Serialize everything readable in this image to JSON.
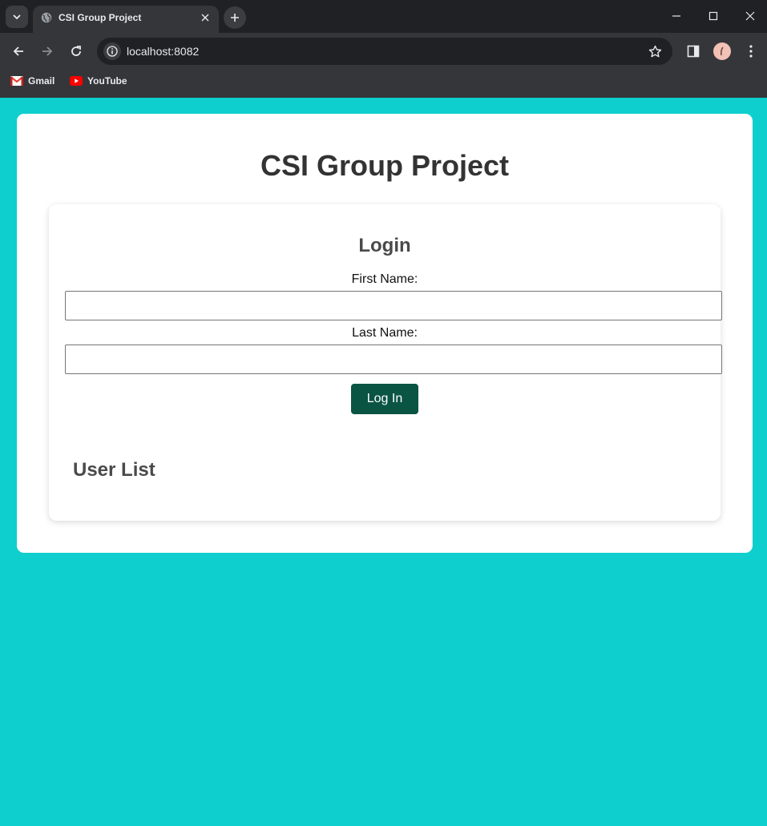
{
  "browser": {
    "tab_title": "CSI Group Project",
    "url": "localhost:8082",
    "bookmarks": [
      {
        "label": "Gmail",
        "icon": "gmail-icon"
      },
      {
        "label": "YouTube",
        "icon": "youtube-icon"
      }
    ]
  },
  "page": {
    "title": "CSI Group Project",
    "background_color": "#0ecfcd",
    "login": {
      "heading": "Login",
      "first_name_label": "First Name:",
      "first_name_value": "",
      "last_name_label": "Last Name:",
      "last_name_value": "",
      "submit_label": "Log In",
      "button_color": "#0a5444"
    },
    "user_list": {
      "heading": "User List",
      "items": []
    }
  }
}
